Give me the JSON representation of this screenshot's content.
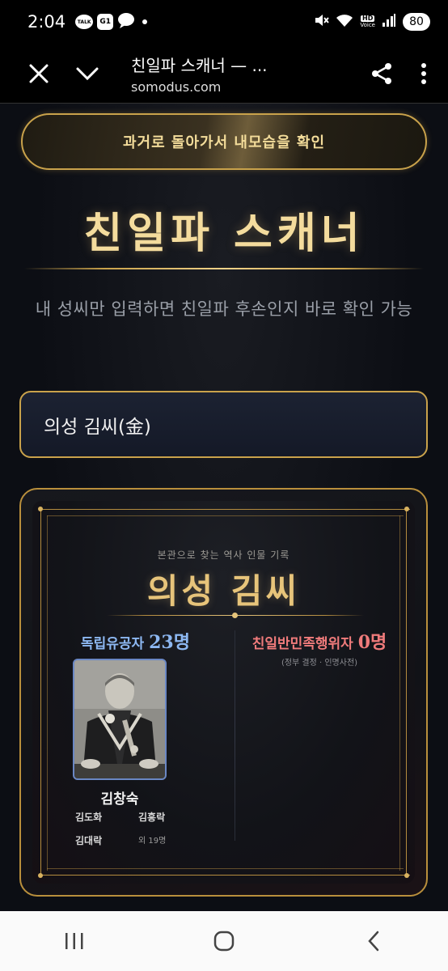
{
  "status_bar": {
    "time": "2:04",
    "icons_left": [
      "talk-icon",
      "g1-icon",
      "chat-icon",
      "dot-icon"
    ],
    "talk_label": "TALK",
    "g1_label": "G1",
    "icons_right": [
      "mute-icon",
      "wifi-icon",
      "hd-voice-icon",
      "signal-icon"
    ],
    "hd_label": "HD",
    "voice_label": "Voice",
    "battery": "80"
  },
  "browser": {
    "title": "친일파 스캐너 — ...",
    "url": "somodus.com",
    "close_icon": "close-icon",
    "menu_icon": "chevron-down-icon",
    "share_icon": "share-icon",
    "more_icon": "more-vertical-icon"
  },
  "page": {
    "top_button": "과거로 돌아가서 내모습을 확인",
    "title": "친일파 스캐너",
    "subtitle": "내 성씨만 입력하면 친일파 후손인지 바로 확인 가능",
    "search_value": "의성 김씨(金)"
  },
  "card": {
    "kicker": "본관으로 찾는 역사 인물 기록",
    "title": "의성 김씨",
    "left": {
      "label": "독립유공자",
      "count": "23명",
      "featured_name": "김창숙",
      "names": [
        "김도화",
        "김흥락",
        "김대락"
      ],
      "more": "외 19명"
    },
    "right": {
      "label": "친일반민족행위자",
      "count": "0명",
      "note": "(정부 결정 · 인명사전)"
    }
  },
  "colors": {
    "gold": "#c9a24b",
    "title_gold": "#f4dc9d",
    "blue": "#8db8f2",
    "red": "#f07b7b"
  },
  "nav": {
    "recent_icon": "recent-apps-icon",
    "home_icon": "home-icon",
    "back_icon": "back-icon"
  }
}
